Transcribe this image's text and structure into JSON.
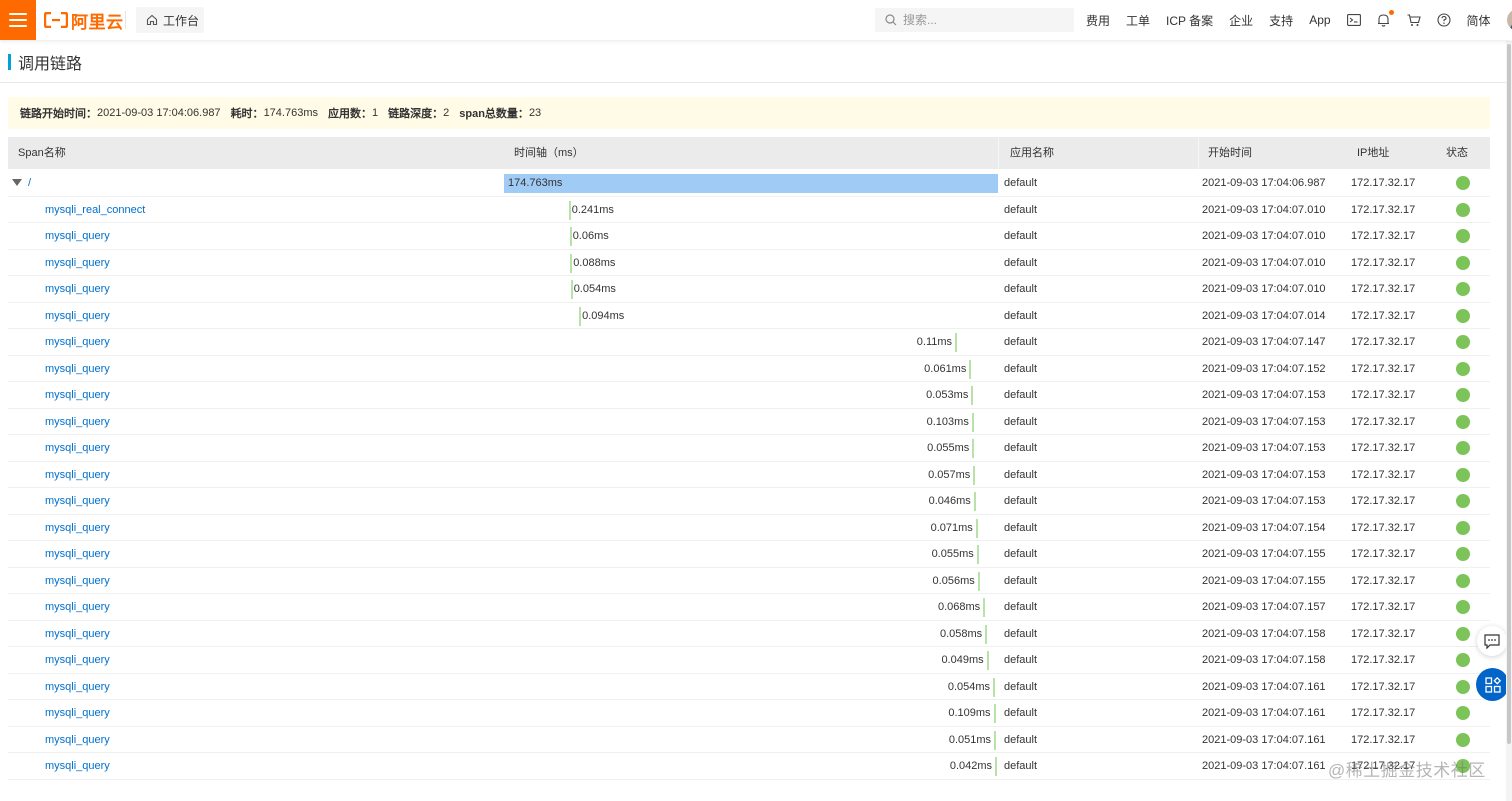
{
  "topbar": {
    "logo_text": "阿里云",
    "workbench_label": "工作台",
    "search_placeholder": "搜索...",
    "nav": [
      "费用",
      "工单",
      "ICP 备案",
      "企业",
      "支持",
      "App"
    ],
    "language": "简体",
    "accent_color": "#ff6a00"
  },
  "page": {
    "title": "调用链路"
  },
  "summary": {
    "start_time_label": "链路开始时间：",
    "start_time": "2021-09-03 17:04:06.987",
    "duration_label": "耗时：",
    "duration": "174.763ms",
    "app_count_label": "应用数：",
    "app_count": "1",
    "depth_label": "链路深度：",
    "depth": "2",
    "span_count_label": "span总数量：",
    "span_count": "23"
  },
  "table": {
    "columns": [
      "Span名称",
      "时间轴（ms）",
      "应用名称",
      "开始时间",
      "IP地址",
      "状态"
    ],
    "timeline_total_ms": 174.763,
    "rows": [
      {
        "name": "/",
        "duration": "174.763ms",
        "offset": 0.0,
        "ms": 174.763,
        "app": "default",
        "start": "2021-09-03 17:04:06.987",
        "ip": "172.17.32.17",
        "root": true
      },
      {
        "name": "mysqli_real_connect",
        "duration": "0.241ms",
        "offset": 0.131,
        "ms": 0.241,
        "app": "default",
        "start": "2021-09-03 17:04:07.010",
        "ip": "172.17.32.17"
      },
      {
        "name": "mysqli_query",
        "duration": "0.06ms",
        "offset": 0.133,
        "ms": 0.06,
        "app": "default",
        "start": "2021-09-03 17:04:07.010",
        "ip": "172.17.32.17"
      },
      {
        "name": "mysqli_query",
        "duration": "0.088ms",
        "offset": 0.134,
        "ms": 0.088,
        "app": "default",
        "start": "2021-09-03 17:04:07.010",
        "ip": "172.17.32.17"
      },
      {
        "name": "mysqli_query",
        "duration": "0.054ms",
        "offset": 0.135,
        "ms": 0.054,
        "app": "default",
        "start": "2021-09-03 17:04:07.010",
        "ip": "172.17.32.17"
      },
      {
        "name": "mysqli_query",
        "duration": "0.094ms",
        "offset": 0.152,
        "ms": 0.094,
        "app": "default",
        "start": "2021-09-03 17:04:07.014",
        "ip": "172.17.32.17"
      },
      {
        "name": "mysqli_query",
        "duration": "0.11ms",
        "offset": 0.913,
        "ms": 0.11,
        "app": "default",
        "start": "2021-09-03 17:04:07.147",
        "ip": "172.17.32.17"
      },
      {
        "name": "mysqli_query",
        "duration": "0.061ms",
        "offset": 0.942,
        "ms": 0.061,
        "app": "default",
        "start": "2021-09-03 17:04:07.152",
        "ip": "172.17.32.17"
      },
      {
        "name": "mysqli_query",
        "duration": "0.053ms",
        "offset": 0.946,
        "ms": 0.053,
        "app": "default",
        "start": "2021-09-03 17:04:07.153",
        "ip": "172.17.32.17"
      },
      {
        "name": "mysqli_query",
        "duration": "0.103ms",
        "offset": 0.947,
        "ms": 0.103,
        "app": "default",
        "start": "2021-09-03 17:04:07.153",
        "ip": "172.17.32.17"
      },
      {
        "name": "mysqli_query",
        "duration": "0.055ms",
        "offset": 0.948,
        "ms": 0.055,
        "app": "default",
        "start": "2021-09-03 17:04:07.153",
        "ip": "172.17.32.17"
      },
      {
        "name": "mysqli_query",
        "duration": "0.057ms",
        "offset": 0.95,
        "ms": 0.057,
        "app": "default",
        "start": "2021-09-03 17:04:07.153",
        "ip": "172.17.32.17"
      },
      {
        "name": "mysqli_query",
        "duration": "0.046ms",
        "offset": 0.951,
        "ms": 0.046,
        "app": "default",
        "start": "2021-09-03 17:04:07.153",
        "ip": "172.17.32.17"
      },
      {
        "name": "mysqli_query",
        "duration": "0.071ms",
        "offset": 0.955,
        "ms": 0.071,
        "app": "default",
        "start": "2021-09-03 17:04:07.154",
        "ip": "172.17.32.17"
      },
      {
        "name": "mysqli_query",
        "duration": "0.055ms",
        "offset": 0.957,
        "ms": 0.055,
        "app": "default",
        "start": "2021-09-03 17:04:07.155",
        "ip": "172.17.32.17"
      },
      {
        "name": "mysqli_query",
        "duration": "0.056ms",
        "offset": 0.959,
        "ms": 0.056,
        "app": "default",
        "start": "2021-09-03 17:04:07.155",
        "ip": "172.17.32.17"
      },
      {
        "name": "mysqli_query",
        "duration": "0.068ms",
        "offset": 0.97,
        "ms": 0.068,
        "app": "default",
        "start": "2021-09-03 17:04:07.157",
        "ip": "172.17.32.17"
      },
      {
        "name": "mysqli_query",
        "duration": "0.058ms",
        "offset": 0.974,
        "ms": 0.058,
        "app": "default",
        "start": "2021-09-03 17:04:07.158",
        "ip": "172.17.32.17"
      },
      {
        "name": "mysqli_query",
        "duration": "0.049ms",
        "offset": 0.977,
        "ms": 0.049,
        "app": "default",
        "start": "2021-09-03 17:04:07.158",
        "ip": "172.17.32.17"
      },
      {
        "name": "mysqli_query",
        "duration": "0.054ms",
        "offset": 0.99,
        "ms": 0.054,
        "app": "default",
        "start": "2021-09-03 17:04:07.161",
        "ip": "172.17.32.17"
      },
      {
        "name": "mysqli_query",
        "duration": "0.109ms",
        "offset": 0.991,
        "ms": 0.109,
        "app": "default",
        "start": "2021-09-03 17:04:07.161",
        "ip": "172.17.32.17"
      },
      {
        "name": "mysqli_query",
        "duration": "0.051ms",
        "offset": 0.992,
        "ms": 0.051,
        "app": "default",
        "start": "2021-09-03 17:04:07.161",
        "ip": "172.17.32.17"
      },
      {
        "name": "mysqli_query",
        "duration": "0.042ms",
        "offset": 0.994,
        "ms": 0.042,
        "app": "default",
        "start": "2021-09-03 17:04:07.161",
        "ip": "172.17.32.17"
      }
    ],
    "status_color": "#7cc35a",
    "root_bar_color": "#9fcbf5"
  },
  "watermark": "@稀土掘金技术社区"
}
